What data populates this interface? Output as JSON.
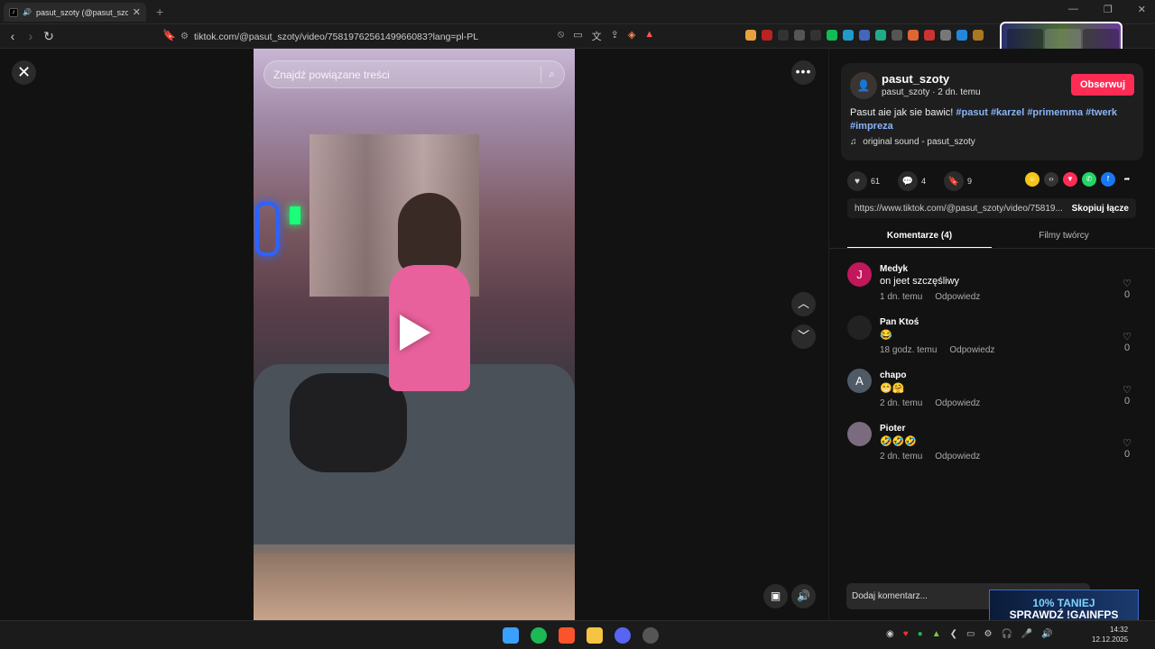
{
  "browser": {
    "tab_title": "pasut_szoty (@pasut_szoty) |",
    "url": "tiktok.com/@pasut_szoty/video/7581976256149966083?lang=pl-PL"
  },
  "viewer": {
    "search_placeholder": "Znajdź powiązane treści"
  },
  "post": {
    "username": "pasut_szoty",
    "subtitle": "pasut_szoty · 2 dn. temu",
    "follow_label": "Obserwuj",
    "caption_text": "Pasut aie jak sie bawic!",
    "hashtags": [
      "#pasut",
      "#karzel",
      "#primemma",
      "#twerk",
      "#impreza"
    ],
    "sound": "original sound - pasut_szoty",
    "likes": "61",
    "comments_count": "4",
    "saves": "9",
    "share_url": "https://www.tiktok.com/@pasut_szoty/video/75819...",
    "copy_label": "Skopiuj łącze"
  },
  "tabs": {
    "comments": "Komentarze (4)",
    "creator_videos": "Filmy twórcy"
  },
  "comments": [
    {
      "initial": "J",
      "avatar_color": "#c2185b",
      "name": "Medyk",
      "text": "on jeet szczęśliwy",
      "time": "1 dn. temu",
      "reply": "Odpowiedz",
      "likes": "0"
    },
    {
      "initial": "",
      "avatar_color": "#222222",
      "name": "Pan Ktoś",
      "text": "😂",
      "time": "18 godz. temu",
      "reply": "Odpowiedz",
      "likes": "0"
    },
    {
      "initial": "A",
      "avatar_color": "#4e5b66",
      "name": "chapo",
      "text": "😁🤗",
      "time": "2 dn. temu",
      "reply": "Odpowiedz",
      "likes": "0"
    },
    {
      "initial": "",
      "avatar_color": "#7a6b7f",
      "name": "Pioter",
      "text": "🤣🤣🤣",
      "time": "2 dn. temu",
      "reply": "Odpowiedz",
      "likes": "0"
    }
  ],
  "comment_input": {
    "placeholder": "Dodaj komentarz..."
  },
  "ad": {
    "line1": "10% TANIEJ",
    "line2": "SPRAWDŹ !GAINFPS"
  },
  "clock": {
    "time": "14:32",
    "date": "12.12.2025"
  },
  "colors": {
    "follow": "#fe2c55",
    "hashtag": "#8ab4f8"
  }
}
